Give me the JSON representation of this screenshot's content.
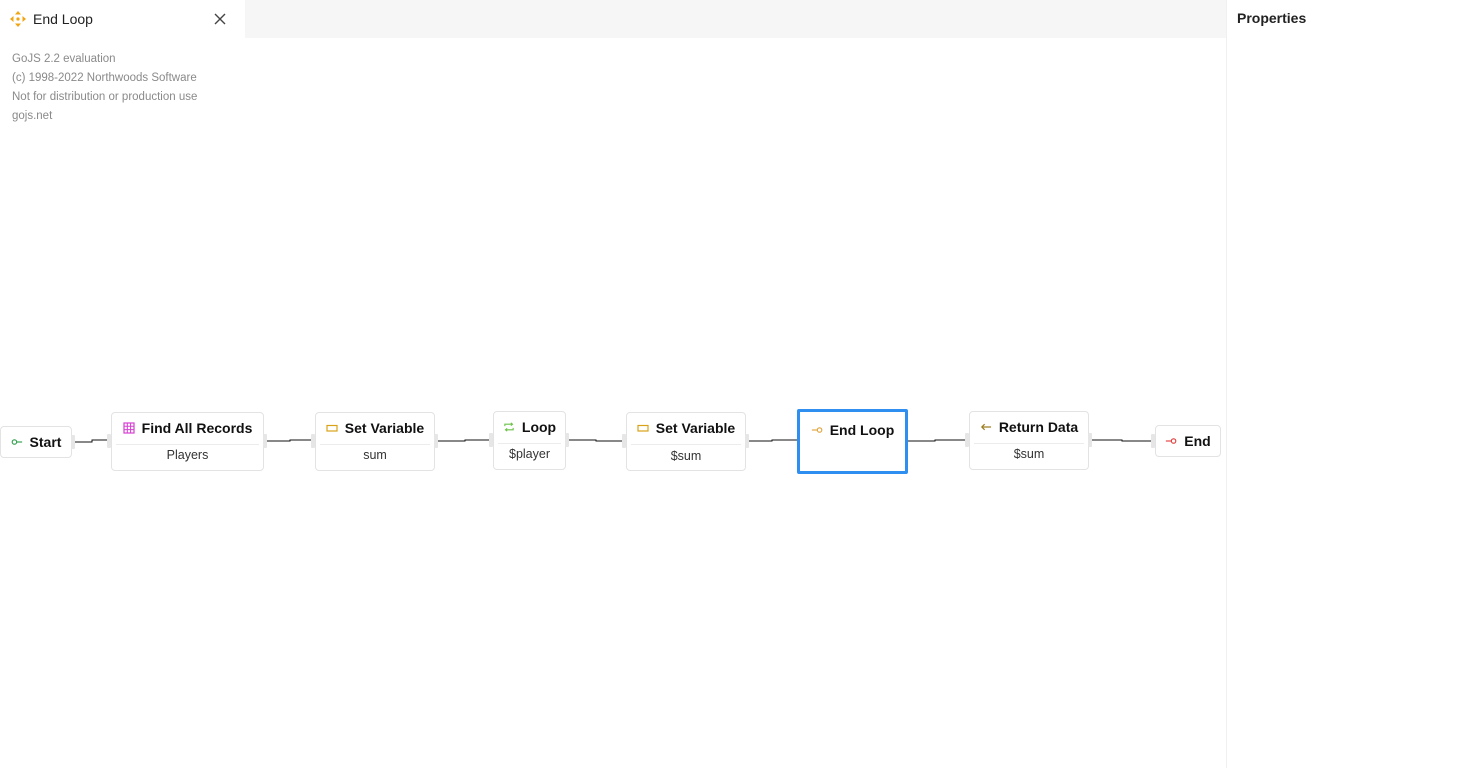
{
  "tab": {
    "title": "End Loop",
    "icon": "move-arrows-icon"
  },
  "properties": {
    "title": "Properties"
  },
  "watermark": {
    "line1": "GoJS 2.2 evaluation",
    "line2": "(c) 1998-2022 Northwoods Software",
    "line3": "Not for distribution or production use",
    "line4": "gojs.net"
  },
  "nodes": {
    "start": {
      "label": "Start",
      "icon": "start-circle-icon",
      "color": "#2e9e4a"
    },
    "find": {
      "label": "Find All Records",
      "sub": "Players",
      "icon": "table-icon",
      "color": "#d53fd2"
    },
    "set1": {
      "label": "Set Variable",
      "sub": "sum",
      "icon": "variable-box-icon",
      "color": "#d8a317"
    },
    "loop": {
      "label": "Loop",
      "sub": "$player",
      "icon": "loop-arrows-icon",
      "color": "#6cc24a"
    },
    "set2": {
      "label": "Set Variable",
      "sub": "$sum",
      "icon": "variable-box-icon",
      "color": "#d8a317"
    },
    "endloop": {
      "label": "End Loop",
      "icon": "end-loop-icon",
      "color": "#e1a23a",
      "selected": true
    },
    "ret": {
      "label": "Return Data",
      "sub": "$sum",
      "icon": "return-arrow-icon",
      "color": "#9a7a1b"
    },
    "end": {
      "label": "End",
      "icon": "end-circle-icon",
      "color": "#e23b3b"
    }
  },
  "colors": {
    "selection": "#2e8ff0",
    "tab_strip": "#f6f6f6"
  }
}
